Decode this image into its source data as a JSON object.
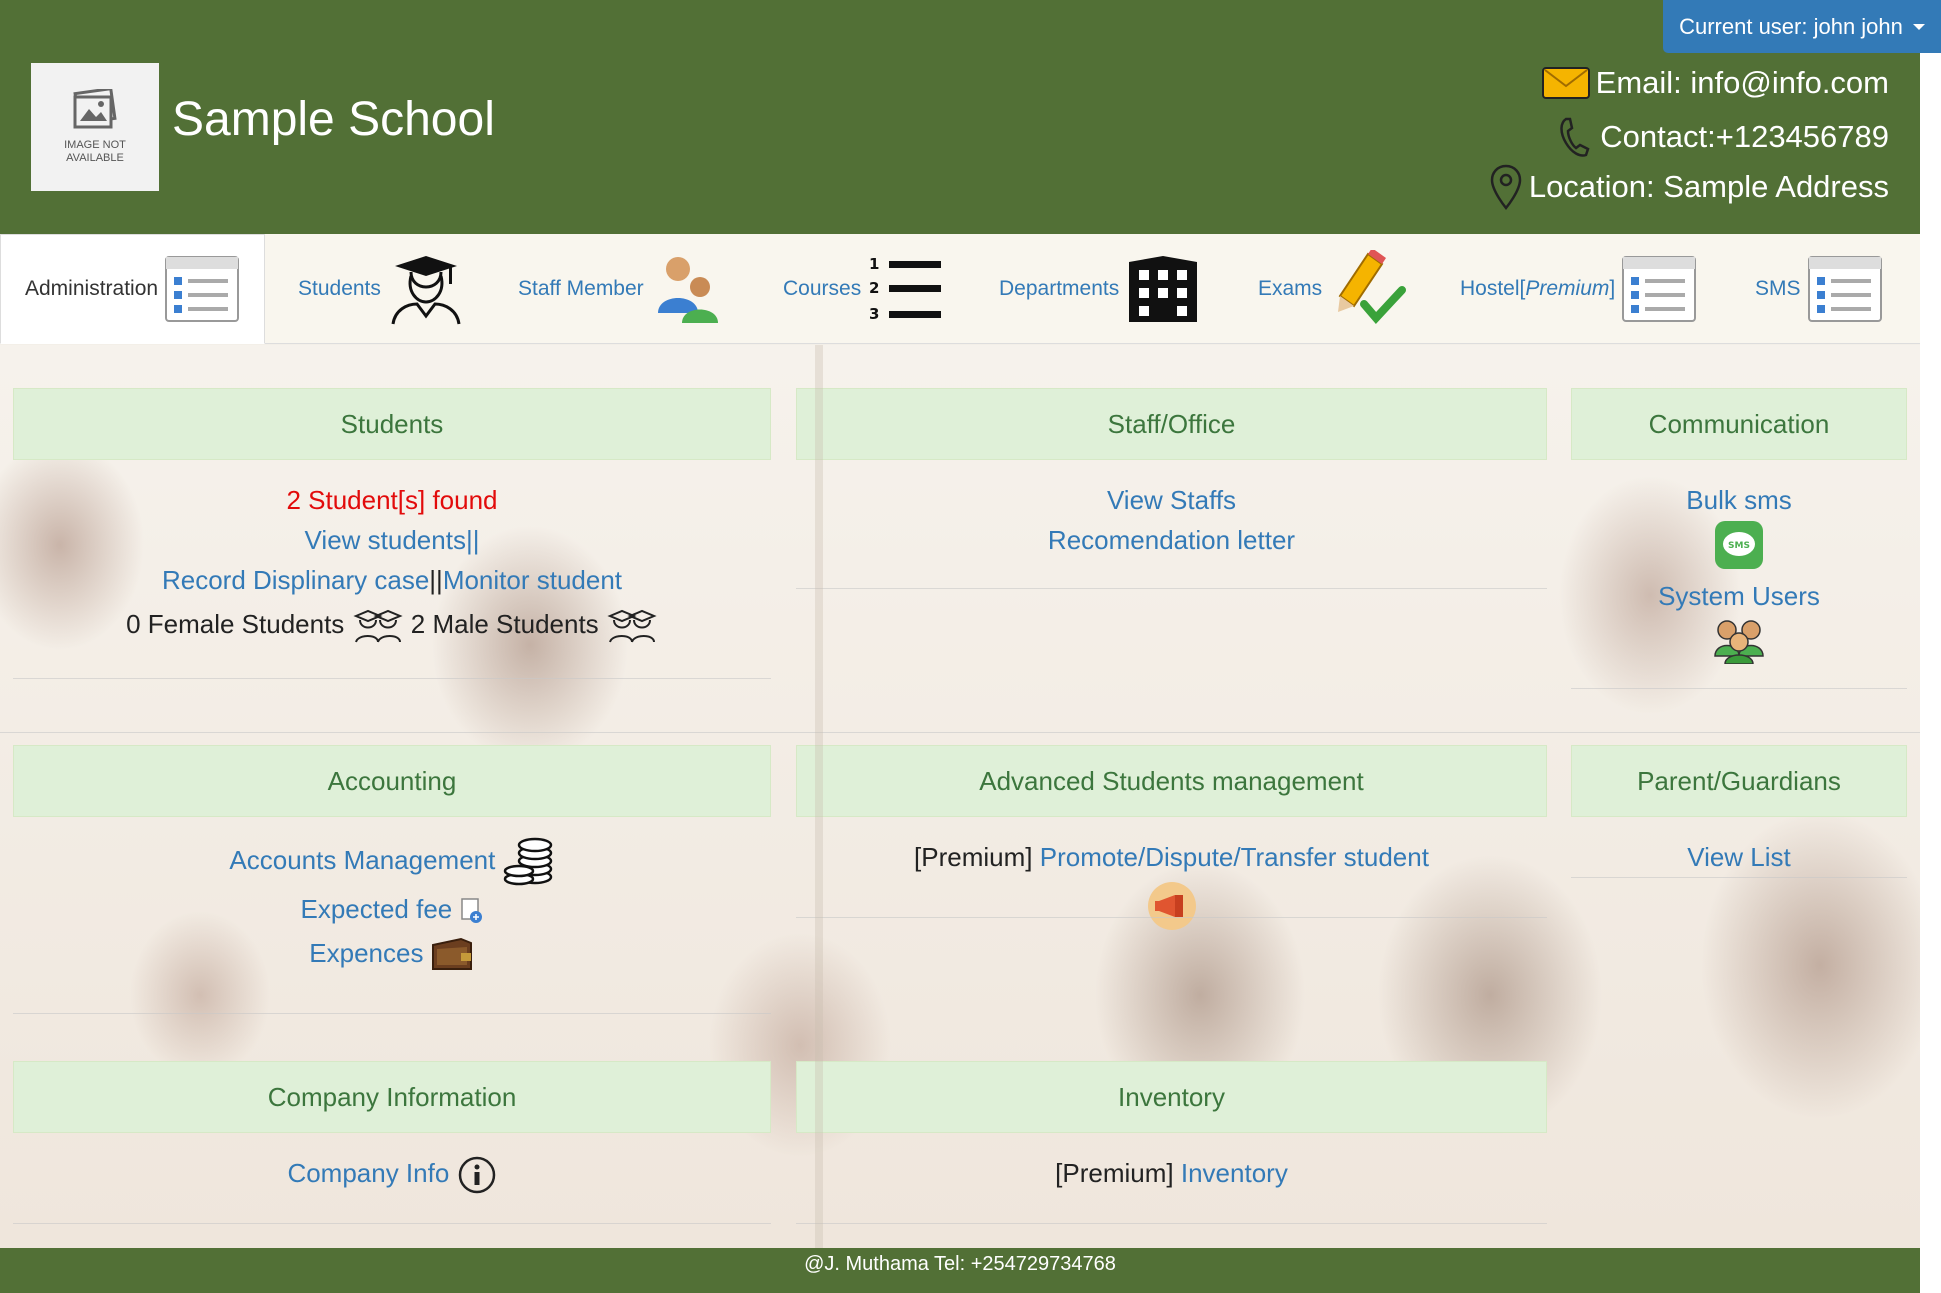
{
  "header": {
    "current_user": "Current user: john john",
    "logo_text": "IMAGE NOT AVAILABLE",
    "school_name": "Sample School",
    "email": "Email: info@info.com",
    "contact": "Contact:+123456789",
    "location": "Location: Sample Address"
  },
  "nav": {
    "items": [
      {
        "label": "Administration"
      },
      {
        "label": "Students"
      },
      {
        "label": "Staff Member"
      },
      {
        "label": "Courses"
      },
      {
        "label": "Departments"
      },
      {
        "label": "Exams"
      },
      {
        "label": "Hostel[",
        "label_em": "Premium",
        "label_end": "]"
      },
      {
        "label": "SMS"
      }
    ]
  },
  "panels": {
    "students": {
      "title": "Students",
      "found": "2 Student[s] found",
      "view_students": "View students||",
      "record_case": "Record Displinary case",
      "separator": "||",
      "monitor": "Monitor student",
      "female": "0 Female Students",
      "male": "2 Male Students"
    },
    "staff": {
      "title": "Staff/Office",
      "view_staffs": "View Staffs",
      "recommendation": "Recomendation letter"
    },
    "communication": {
      "title": "Communication",
      "bulk_sms": "Bulk sms",
      "system_users": "System Users"
    },
    "accounting": {
      "title": "Accounting",
      "accounts": "Accounts Management",
      "expected_fee": "Expected fee",
      "expences": "Expences"
    },
    "advanced": {
      "title": "Advanced Students management",
      "premium": "[Premium]",
      "promote": "Promote/Dispute/Transfer student"
    },
    "parents": {
      "title": "Parent/Guardians",
      "view_list": "View List"
    },
    "company": {
      "title": "Company Information",
      "company_info": "Company Info"
    },
    "inventory": {
      "title": "Inventory",
      "premium": "[Premium]",
      "inventory": "Inventory"
    }
  },
  "footer": {
    "text": "@J. Muthama Tel: +254729734768"
  },
  "colors": {
    "header_bg": "#527036",
    "panel_head_bg": "#dff0d8",
    "panel_head_text": "#3c763d",
    "link": "#337ab7",
    "alert": "#e20b0b",
    "user_button": "#337ab7"
  }
}
